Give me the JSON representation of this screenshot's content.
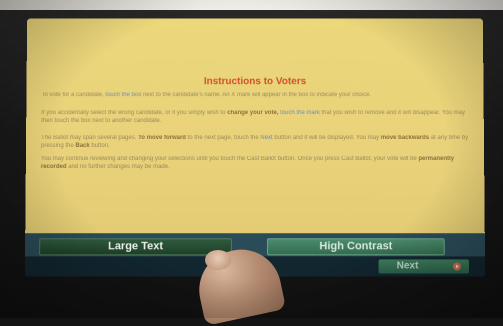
{
  "instructions": {
    "title": "Instructions to Voters",
    "paragraphs": [
      {
        "a": "To vote for a candidate,",
        "b": "touch the box",
        "c": "next to the candidate's name. An X mark will appear in the box to indicate your choice."
      },
      {
        "a": "If you accidentally select the wrong candidate, or if you simply wish to",
        "b": "change your vote,",
        "c": "touch the mark",
        "d": "that you wish to remove and it will disappear. You may then touch the box next to another candidate."
      },
      {
        "a": "The Ballot may span several pages.",
        "b": "To move forward",
        "c": "to the next page, touch the",
        "d": "Next",
        "e": "button and it will be displayed. You may",
        "f": "move backwards",
        "g": "at any time by pressing the",
        "h": "Back",
        "i": "button."
      },
      {
        "a": "You may continue reviewing and changing your selections until you touch the Cast Ballot button. Once you press Cast Ballot, your vote will be",
        "b": "permanently recorded",
        "c": "and no further changes may be made."
      }
    ]
  },
  "buttons": {
    "large_text": "Large Text",
    "high_contrast": "High Contrast",
    "next": "Next"
  },
  "colors": {
    "background": "#e9d27a",
    "title": "#d2502a",
    "button_bar": "#2a4b58",
    "large_text_button": "#2f5a3d",
    "high_contrast_button": "#4b8a6c"
  }
}
